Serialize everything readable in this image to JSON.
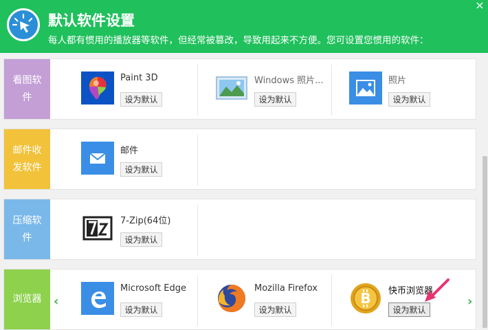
{
  "header": {
    "title": "默认软件设置",
    "subtitle": "每人都有惯用的播放器等软件，但经常被篡改，导致用起来不方便。您可设置您惯用的软件：",
    "close": "×"
  },
  "colors": {
    "header_green": "#20c05c",
    "image_label": "#c39fd6",
    "mail_label": "#f2c23b",
    "compress_label": "#7bb8ea",
    "browser_label": "#8dd14d"
  },
  "categories": [
    {
      "label": "看图软件",
      "apps": [
        {
          "name": "Paint 3D",
          "button": "设为默认",
          "icon": "paint3d-icon"
        },
        {
          "name": "Windows 照片...",
          "button": "设为默认",
          "icon": "windows-photo-icon"
        },
        {
          "name": "照片",
          "button": "设为默认",
          "icon": "photos-icon"
        }
      ]
    },
    {
      "label": "邮件收发软件",
      "apps": [
        {
          "name": "邮件",
          "button": "设为默认",
          "icon": "mail-icon"
        }
      ]
    },
    {
      "label": "压缩软件",
      "apps": [
        {
          "name": "7-Zip(64位)",
          "button": "设为默认",
          "icon": "7zip-icon"
        }
      ]
    },
    {
      "label": "浏览器",
      "apps": [
        {
          "name": "Microsoft Edge",
          "button": "设为默认",
          "icon": "edge-icon"
        },
        {
          "name": "Mozilla Firefox",
          "button": "设为默认",
          "icon": "firefox-icon"
        },
        {
          "name": "快币浏览器",
          "button": "设为默认",
          "icon": "bitcoin-browser-icon"
        }
      ]
    }
  ],
  "nav": {
    "prev": "‹",
    "next": "›"
  }
}
